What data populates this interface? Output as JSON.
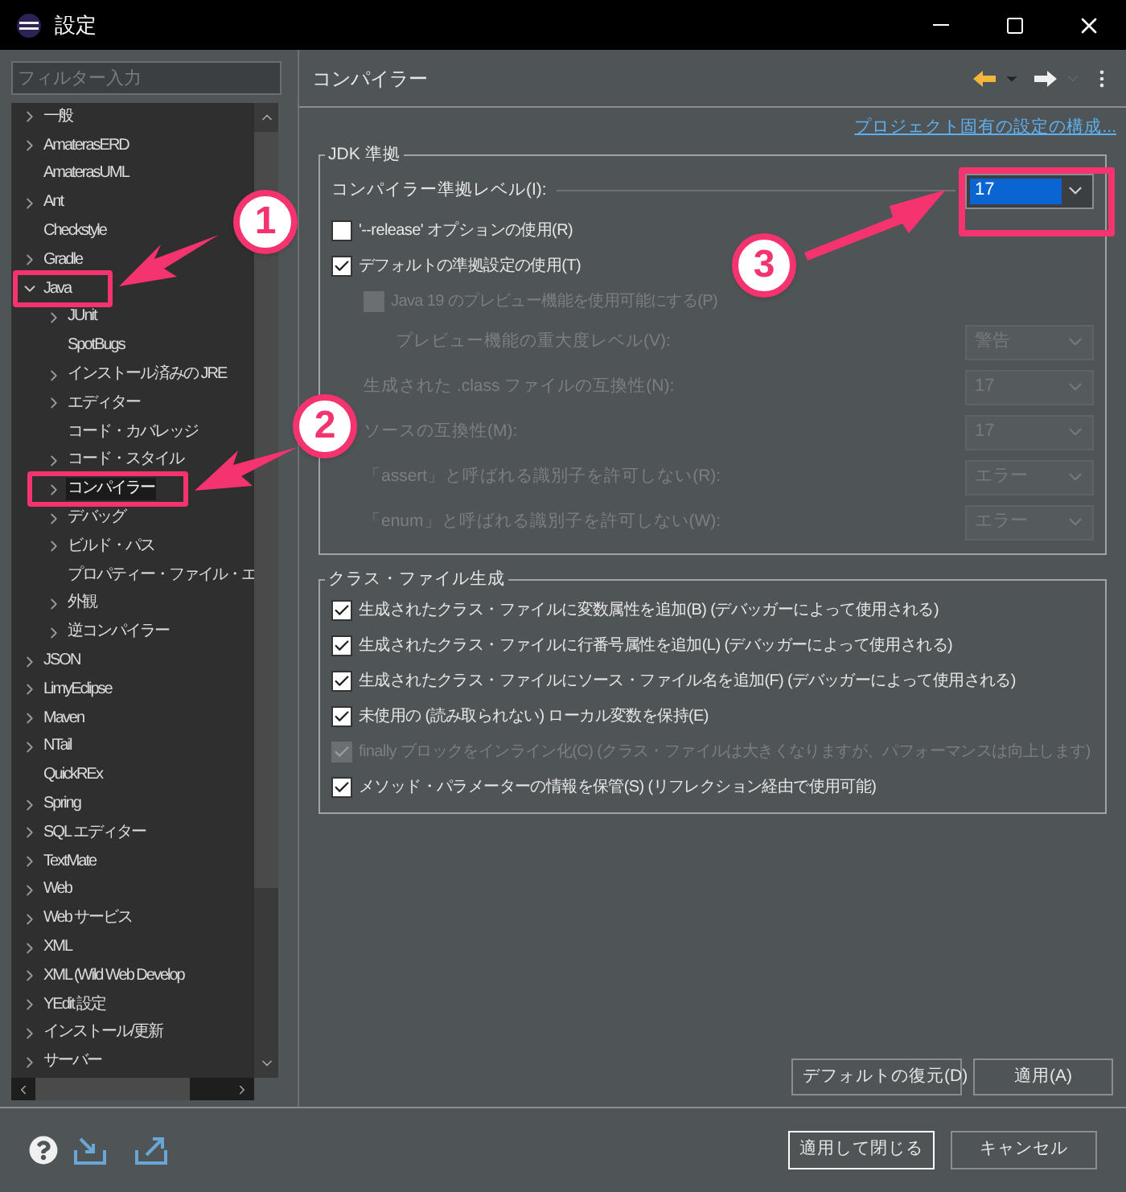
{
  "window": {
    "title": "設定"
  },
  "filter": {
    "placeholder": "フィルター入力"
  },
  "tree": [
    {
      "label": "一般",
      "kind": "folder",
      "expanded": false,
      "selected": false
    },
    {
      "label": "AmaterasERD",
      "kind": "folder",
      "expanded": false,
      "selected": false
    },
    {
      "label": "AmaterasUML",
      "kind": "leaf",
      "selected": false
    },
    {
      "label": "Ant",
      "kind": "folder",
      "expanded": false,
      "selected": false
    },
    {
      "label": "Checkstyle",
      "kind": "leaf",
      "selected": false
    },
    {
      "label": "Gradle",
      "kind": "folder",
      "expanded": false,
      "selected": false
    },
    {
      "label": "Java",
      "kind": "folder",
      "expanded": true,
      "selected": false,
      "children": [
        {
          "label": "JUnit",
          "kind": "folder",
          "expanded": false,
          "selected": false
        },
        {
          "label": "SpotBugs",
          "kind": "leaf",
          "selected": false
        },
        {
          "label": "インストール済みの JRE",
          "kind": "folder",
          "expanded": false,
          "selected": false
        },
        {
          "label": "エディター",
          "kind": "folder",
          "expanded": false,
          "selected": false
        },
        {
          "label": "コード・カバレッジ",
          "kind": "leaf",
          "selected": false
        },
        {
          "label": "コード・スタイル",
          "kind": "folder",
          "expanded": false,
          "selected": false
        },
        {
          "label": "コンパイラー",
          "kind": "folder",
          "expanded": false,
          "selected": true
        },
        {
          "label": "デバッグ",
          "kind": "folder",
          "expanded": false,
          "selected": false
        },
        {
          "label": "ビルド・パス",
          "kind": "folder",
          "expanded": false,
          "selected": false
        },
        {
          "label": "プロパティー・ファイル・エ",
          "kind": "leaf",
          "selected": false
        },
        {
          "label": "外観",
          "kind": "folder",
          "expanded": false,
          "selected": false
        },
        {
          "label": "逆コンパイラー",
          "kind": "folder",
          "expanded": false,
          "selected": false
        }
      ]
    },
    {
      "label": "JSON",
      "kind": "folder",
      "expanded": false,
      "selected": false
    },
    {
      "label": "LimyEclipse",
      "kind": "folder",
      "expanded": false,
      "selected": false
    },
    {
      "label": "Maven",
      "kind": "folder",
      "expanded": false,
      "selected": false
    },
    {
      "label": "NTail",
      "kind": "folder",
      "expanded": false,
      "selected": false
    },
    {
      "label": "QuickREx",
      "kind": "leaf",
      "selected": false
    },
    {
      "label": "Spring",
      "kind": "folder",
      "expanded": false,
      "selected": false
    },
    {
      "label": "SQL エディター",
      "kind": "folder",
      "expanded": false,
      "selected": false
    },
    {
      "label": "TextMate",
      "kind": "folder",
      "expanded": false,
      "selected": false
    },
    {
      "label": "Web",
      "kind": "folder",
      "expanded": false,
      "selected": false
    },
    {
      "label": "Web サービス",
      "kind": "folder",
      "expanded": false,
      "selected": false
    },
    {
      "label": "XML",
      "kind": "folder",
      "expanded": false,
      "selected": false
    },
    {
      "label": "XML (Wild Web Develop",
      "kind": "folder",
      "expanded": false,
      "selected": false
    },
    {
      "label": "YEdit 設定",
      "kind": "folder",
      "expanded": false,
      "selected": false
    },
    {
      "label": "インストール/更新",
      "kind": "folder",
      "expanded": false,
      "selected": false
    },
    {
      "label": "サーバー",
      "kind": "folder",
      "expanded": false,
      "selected": false
    }
  ],
  "page": {
    "title": "コンパイラー",
    "link": "プロジェクト固有の設定の構成...",
    "groups": [
      {
        "title": "JDK 準拠",
        "rows": [
          {
            "kind": "combo",
            "label": "コンパイラー準拠レベル(I):",
            "value": "17",
            "disabled": false
          },
          {
            "kind": "checkbox",
            "label": "'--release' オプションの使用(R)",
            "checked": false,
            "disabled": false
          },
          {
            "kind": "checkbox",
            "label": "デフォルトの準拠設定の使用(T)",
            "checked": true,
            "disabled": false,
            "children": [
              {
                "kind": "checkbox",
                "label": "Java 19 のプレビュー機能を使用可能にする(P)",
                "checked": false,
                "disabled": true,
                "children": [
                  {
                    "kind": "combo",
                    "label": "プレビュー機能の重大度レベル(V):",
                    "value": "警告",
                    "disabled": true
                  }
                ]
              },
              {
                "kind": "combo",
                "label": "生成された .class ファイルの互換性(N):",
                "value": "17",
                "disabled": true
              },
              {
                "kind": "combo",
                "label": "ソースの互換性(M):",
                "value": "17",
                "disabled": true
              },
              {
                "kind": "combo",
                "label": "「assert」と呼ばれる識別子を許可しない(R):",
                "value": "エラー",
                "disabled": true
              },
              {
                "kind": "combo",
                "label": "「enum」と呼ばれる識別子を許可しない(W):",
                "value": "エラー",
                "disabled": true
              }
            ]
          }
        ]
      },
      {
        "title": "クラス・ファイル生成",
        "rows": [
          {
            "kind": "checkbox",
            "label": "生成されたクラス・ファイルに変数属性を追加(B) (デバッガーによって使用される)",
            "checked": true,
            "disabled": false
          },
          {
            "kind": "checkbox",
            "label": "生成されたクラス・ファイルに行番号属性を追加(L) (デバッガーによって使用される)",
            "checked": true,
            "disabled": false
          },
          {
            "kind": "checkbox",
            "label": "生成されたクラス・ファイルにソース・ファイル名を追加(F) (デバッガーによって使用される)",
            "checked": true,
            "disabled": false
          },
          {
            "kind": "checkbox",
            "label": "未使用の (読み取られない) ローカル変数を保持(E)",
            "checked": true,
            "disabled": false
          },
          {
            "kind": "checkbox",
            "label": "finally ブロックをインライン化(C) (クラス・ファイルは大きくなりますが、パフォーマンスは向上します)",
            "checked": true,
            "disabled": true
          },
          {
            "kind": "checkbox",
            "label": "メソッド・パラメーターの情報を保管(S) (リフレクション経由で使用可能)",
            "checked": true,
            "disabled": false
          }
        ]
      }
    ],
    "buttons": [
      "デフォルトの復元(D)",
      "適用(A)"
    ]
  },
  "footer": {
    "buttons": [
      {
        "label": "適用して閉じる",
        "default": true
      },
      {
        "label": "キャンセル",
        "default": false
      }
    ]
  },
  "annotations": [
    "1",
    "2",
    "3"
  ]
}
